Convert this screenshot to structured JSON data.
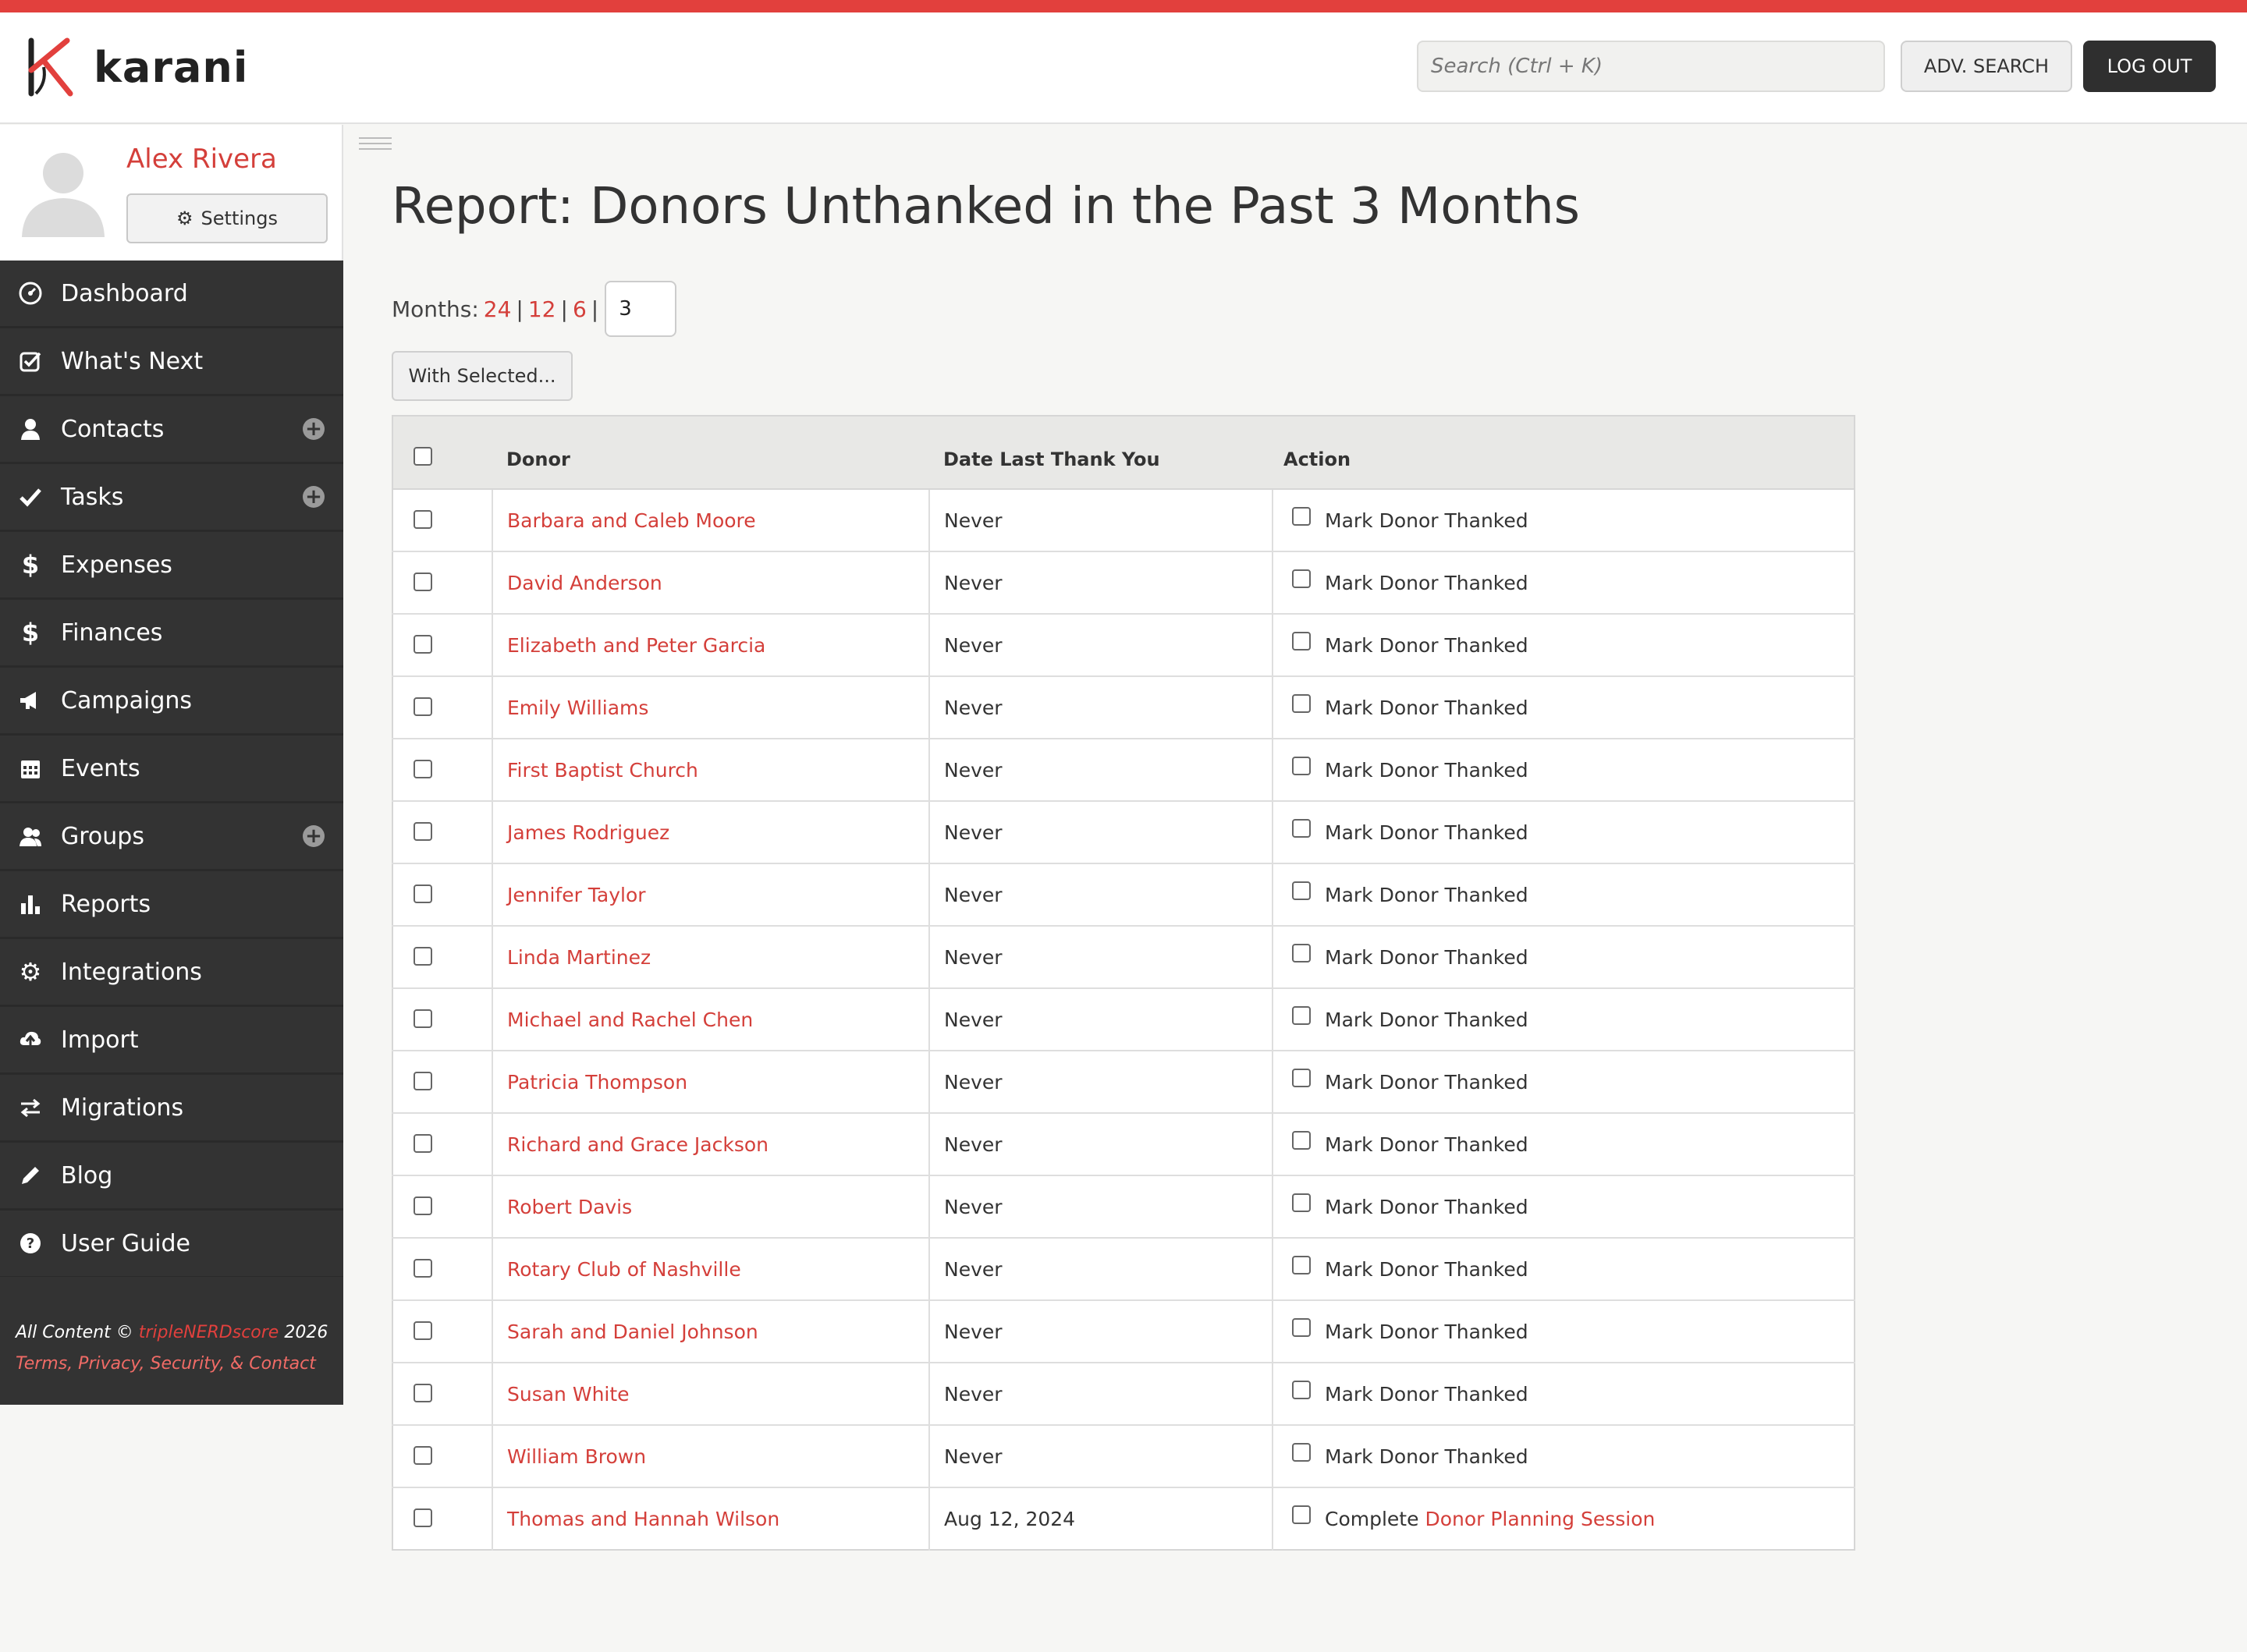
{
  "brand": {
    "name": "karani",
    "accent": "#e2403d"
  },
  "header": {
    "search_placeholder": "Search (Ctrl + K)",
    "adv_search_label": "ADV. SEARCH",
    "logout_label": "LOG OUT"
  },
  "profile": {
    "name": "Alex Rivera",
    "settings_label": "Settings"
  },
  "sidebar": {
    "items": [
      {
        "label": "Dashboard",
        "icon": "dashboard-icon"
      },
      {
        "label": "What's Next",
        "icon": "check-square-icon"
      },
      {
        "label": "Contacts",
        "icon": "user-icon",
        "plus": true
      },
      {
        "label": "Tasks",
        "icon": "check-icon",
        "plus": true
      },
      {
        "label": "Expenses",
        "icon": "dollar-icon"
      },
      {
        "label": "Finances",
        "icon": "dollar-icon"
      },
      {
        "label": "Campaigns",
        "icon": "megaphone-icon"
      },
      {
        "label": "Events",
        "icon": "calendar-icon"
      },
      {
        "label": "Groups",
        "icon": "group-icon",
        "plus": true
      },
      {
        "label": "Reports",
        "icon": "bar-chart-icon"
      },
      {
        "label": "Integrations",
        "icon": "gear-icon"
      },
      {
        "label": "Import",
        "icon": "cloud-upload-icon"
      },
      {
        "label": "Migrations",
        "icon": "exchange-icon"
      },
      {
        "label": "Blog",
        "icon": "pencil-icon"
      },
      {
        "label": "User Guide",
        "icon": "question-icon"
      }
    ],
    "footer": {
      "prefix": "All Content ©",
      "company": "tripleNERDscore",
      "year": "2026",
      "links": "Terms, Privacy, Security, & Contact"
    }
  },
  "main": {
    "title": "Report: Donors Unthanked in the Past 3 Months",
    "months_label": "Months:",
    "month_options": [
      "24",
      "12",
      "6"
    ],
    "months_value": "3",
    "with_selected_label": "With Selected...",
    "table": {
      "headers": {
        "donor": "Donor",
        "date": "Date Last Thank You",
        "action": "Action"
      },
      "rows": [
        {
          "donor": "Barbara and Caleb Moore",
          "date": "Never",
          "action": "Mark Donor Thanked"
        },
        {
          "donor": "David Anderson",
          "date": "Never",
          "action": "Mark Donor Thanked"
        },
        {
          "donor": "Elizabeth and Peter Garcia",
          "date": "Never",
          "action": "Mark Donor Thanked"
        },
        {
          "donor": "Emily Williams",
          "date": "Never",
          "action": "Mark Donor Thanked"
        },
        {
          "donor": "First Baptist Church",
          "date": "Never",
          "action": "Mark Donor Thanked"
        },
        {
          "donor": "James Rodriguez",
          "date": "Never",
          "action": "Mark Donor Thanked"
        },
        {
          "donor": "Jennifer Taylor",
          "date": "Never",
          "action": "Mark Donor Thanked"
        },
        {
          "donor": "Linda Martinez",
          "date": "Never",
          "action": "Mark Donor Thanked"
        },
        {
          "donor": "Michael and Rachel Chen",
          "date": "Never",
          "action": "Mark Donor Thanked"
        },
        {
          "donor": "Patricia Thompson",
          "date": "Never",
          "action": "Mark Donor Thanked"
        },
        {
          "donor": "Richard and Grace Jackson",
          "date": "Never",
          "action": "Mark Donor Thanked"
        },
        {
          "donor": "Robert Davis",
          "date": "Never",
          "action": "Mark Donor Thanked"
        },
        {
          "donor": "Rotary Club of Nashville",
          "date": "Never",
          "action": "Mark Donor Thanked"
        },
        {
          "donor": "Sarah and Daniel Johnson",
          "date": "Never",
          "action": "Mark Donor Thanked"
        },
        {
          "donor": "Susan White",
          "date": "Never",
          "action": "Mark Donor Thanked"
        },
        {
          "donor": "William Brown",
          "date": "Never",
          "action": "Mark Donor Thanked"
        },
        {
          "donor": "Thomas and Hannah Wilson",
          "date": "Aug 12, 2024",
          "action": "Complete",
          "action_link": "Donor Planning Session"
        }
      ]
    }
  }
}
